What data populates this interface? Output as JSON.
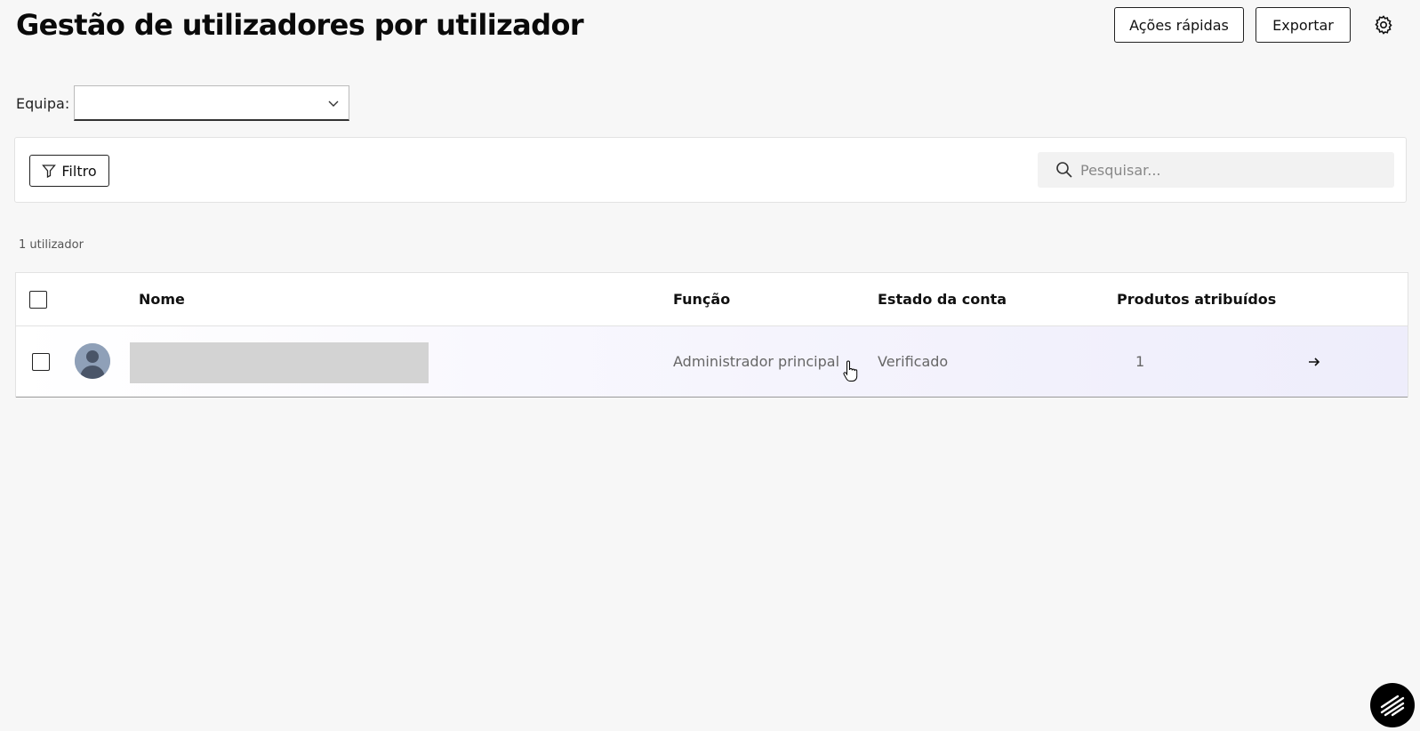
{
  "header": {
    "title": "Gestão de utilizadores por utilizador",
    "quick_actions_label": "Ações rápidas",
    "export_label": "Exportar",
    "settings_icon": "gear-icon"
  },
  "team_filter": {
    "label": "Equipa:",
    "selected_value": ""
  },
  "toolbar": {
    "filter_label": "Filtro",
    "search_placeholder": "Pesquisar..."
  },
  "user_count": "1 utilizador",
  "table": {
    "columns": [
      "Nome",
      "Função",
      "Estado da conta",
      "Produtos atribuídos"
    ],
    "rows": [
      {
        "name": "",
        "role": "Administrador principal",
        "status": "Verificado",
        "assigned_products": "1"
      }
    ]
  },
  "colors": {
    "background": "#f7f7f7",
    "row_highlight": "#eeedfb",
    "redacted_name": "#d3d3d3"
  }
}
